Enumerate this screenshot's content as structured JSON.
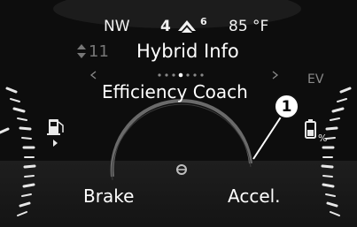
{
  "status_bar": {
    "heading": "NW",
    "road_count": "4",
    "road_sub": "6",
    "temperature": "85 °F"
  },
  "menu": {
    "previous_number": "11",
    "title": "Hybrid Info",
    "page_dots": 7,
    "active_dot": 4
  },
  "screen": {
    "title": "Efficiency Coach",
    "ev_label": "EV",
    "brake_label": "Brake",
    "accel_label": "Accel."
  },
  "callout": {
    "number": "1"
  },
  "icons": {
    "fuel": "fuel-pump-icon",
    "battery": "battery-percent-icon",
    "up_down": "up-down-arrow-icon",
    "road": "road-icon"
  },
  "colors": {
    "background": "#0d0d0d",
    "text": "#ffffff",
    "gauge_arc": "#5a5a5a"
  }
}
